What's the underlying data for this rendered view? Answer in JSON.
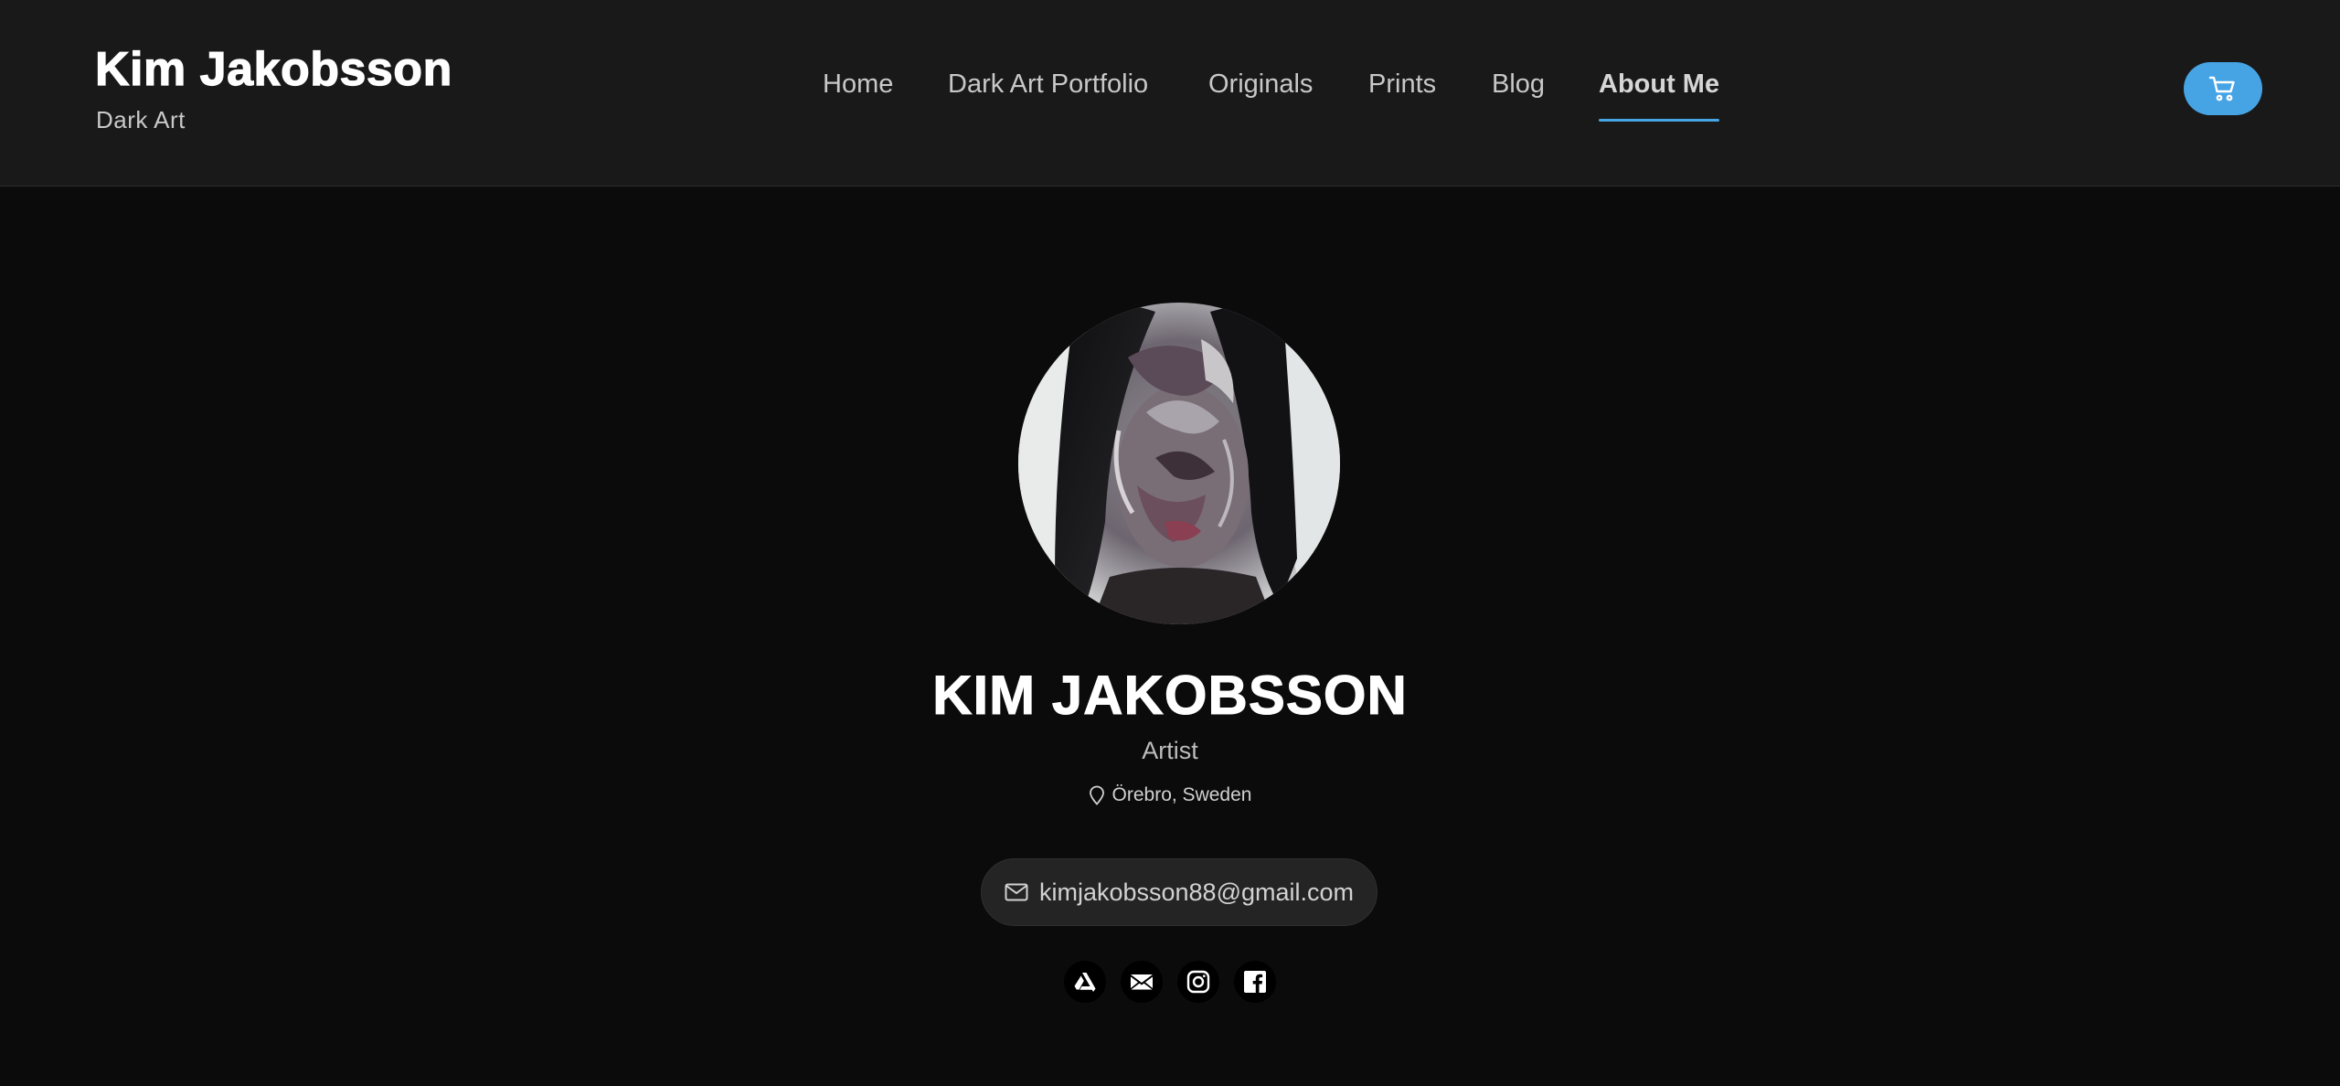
{
  "header": {
    "brand_title": "Kim Jakobsson",
    "brand_subtitle": "Dark Art",
    "nav": [
      {
        "label": "Home",
        "active": false
      },
      {
        "label": "Dark Art Portfolio",
        "active": false
      },
      {
        "label": "Originals",
        "active": false
      },
      {
        "label": "Prints",
        "active": false
      },
      {
        "label": "Blog",
        "active": false
      },
      {
        "label": "About Me",
        "active": true
      }
    ],
    "cart_icon": "cart-icon"
  },
  "profile": {
    "name": "KIM JAKOBSSON",
    "role": "Artist",
    "location": "Örebro, Sweden",
    "email": "kimjakobsson88@gmail.com",
    "socials": [
      "artstation-icon",
      "mail-icon",
      "instagram-icon",
      "facebook-icon"
    ]
  },
  "colors": {
    "accent": "#46a4e4",
    "header_bg": "#191919",
    "page_bg": "#0b0b0b"
  }
}
